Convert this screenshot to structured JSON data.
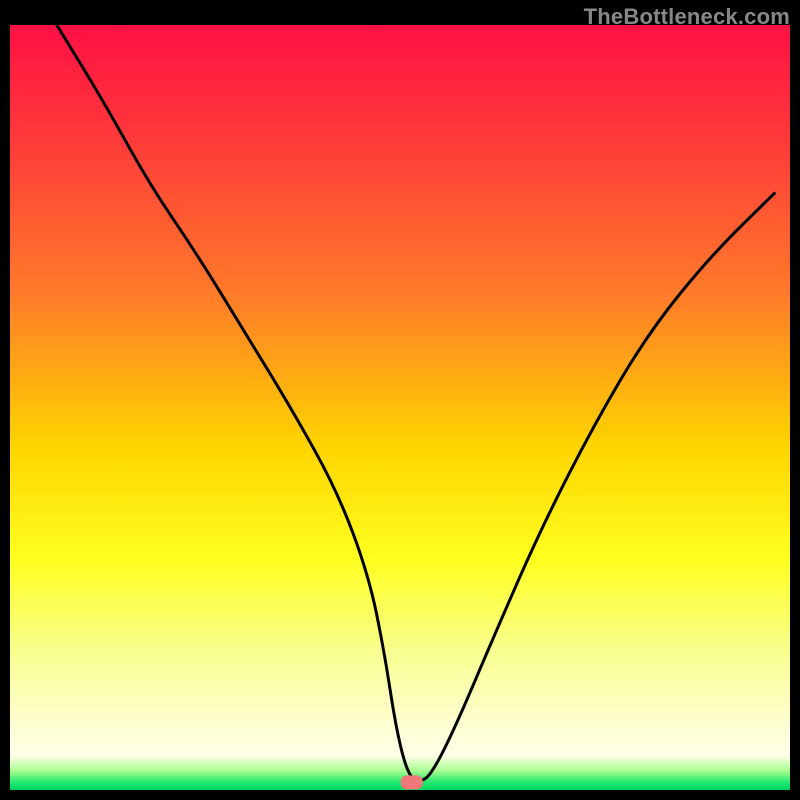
{
  "watermark": "TheBottleneck.com",
  "chart_data": {
    "type": "line",
    "title": "",
    "xlabel": "",
    "ylabel": "",
    "xlim": [
      0,
      100
    ],
    "ylim": [
      0,
      100
    ],
    "background_gradient": {
      "stops": [
        {
          "offset": 0.0,
          "color": "#ff1045"
        },
        {
          "offset": 0.15,
          "color": "#ff3a3a"
        },
        {
          "offset": 0.35,
          "color": "#ff7a2a"
        },
        {
          "offset": 0.55,
          "color": "#ffd400"
        },
        {
          "offset": 0.7,
          "color": "#ffff20"
        },
        {
          "offset": 0.82,
          "color": "#f8ff90"
        },
        {
          "offset": 0.9,
          "color": "#fdffc8"
        },
        {
          "offset": 0.955,
          "color": "#ffffe8"
        },
        {
          "offset": 0.975,
          "color": "#a8ff90"
        },
        {
          "offset": 0.99,
          "color": "#20e870"
        },
        {
          "offset": 1.0,
          "color": "#00d860"
        }
      ]
    },
    "series": [
      {
        "name": "bottleneck-curve",
        "x": [
          6,
          12,
          18,
          24,
          30,
          36,
          42,
          46,
          48,
          49.5,
          51,
          52.5,
          54,
          57,
          62,
          68,
          75,
          82,
          90,
          98
        ],
        "y": [
          100,
          90,
          79,
          70,
          60,
          50,
          39,
          28,
          18,
          8,
          2,
          1,
          2,
          8,
          20,
          34,
          48,
          60,
          70,
          78
        ]
      }
    ],
    "marker": {
      "x": 51.5,
      "y": 1.0,
      "color": "#f07878"
    }
  }
}
